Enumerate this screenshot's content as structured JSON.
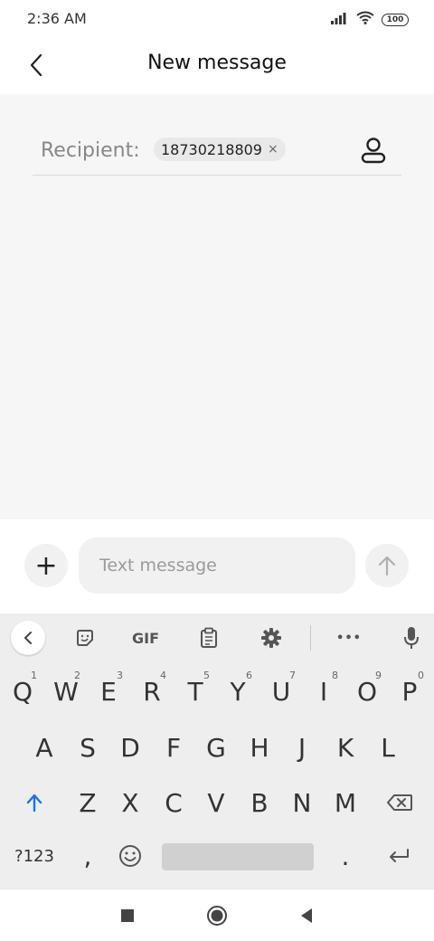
{
  "status_bar": {
    "time": "2:36 AM",
    "battery": "100"
  },
  "header": {
    "title": "New message"
  },
  "recipient": {
    "label": "Recipient:",
    "chip": "18730218809",
    "chip_remove": "×"
  },
  "compose": {
    "plus": "+",
    "placeholder": "Text message"
  },
  "keyboard": {
    "toolbar": {
      "gif": "GIF",
      "more": "•••"
    },
    "row1": [
      {
        "k": "Q",
        "h": "1"
      },
      {
        "k": "W",
        "h": "2"
      },
      {
        "k": "E",
        "h": "3"
      },
      {
        "k": "R",
        "h": "4"
      },
      {
        "k": "T",
        "h": "5"
      },
      {
        "k": "Y",
        "h": "6"
      },
      {
        "k": "U",
        "h": "7"
      },
      {
        "k": "I",
        "h": "8"
      },
      {
        "k": "O",
        "h": "9"
      },
      {
        "k": "P",
        "h": "0"
      }
    ],
    "row2": [
      "A",
      "S",
      "D",
      "F",
      "G",
      "H",
      "J",
      "K",
      "L"
    ],
    "row3": [
      "Z",
      "X",
      "C",
      "V",
      "B",
      "N",
      "M"
    ],
    "row4": {
      "symbols": "?123",
      "comma": ",",
      "period": "."
    }
  },
  "colors": {
    "accent": "#1a73e8",
    "key_text": "#333333",
    "keyboard_bg": "#eeeeee"
  }
}
